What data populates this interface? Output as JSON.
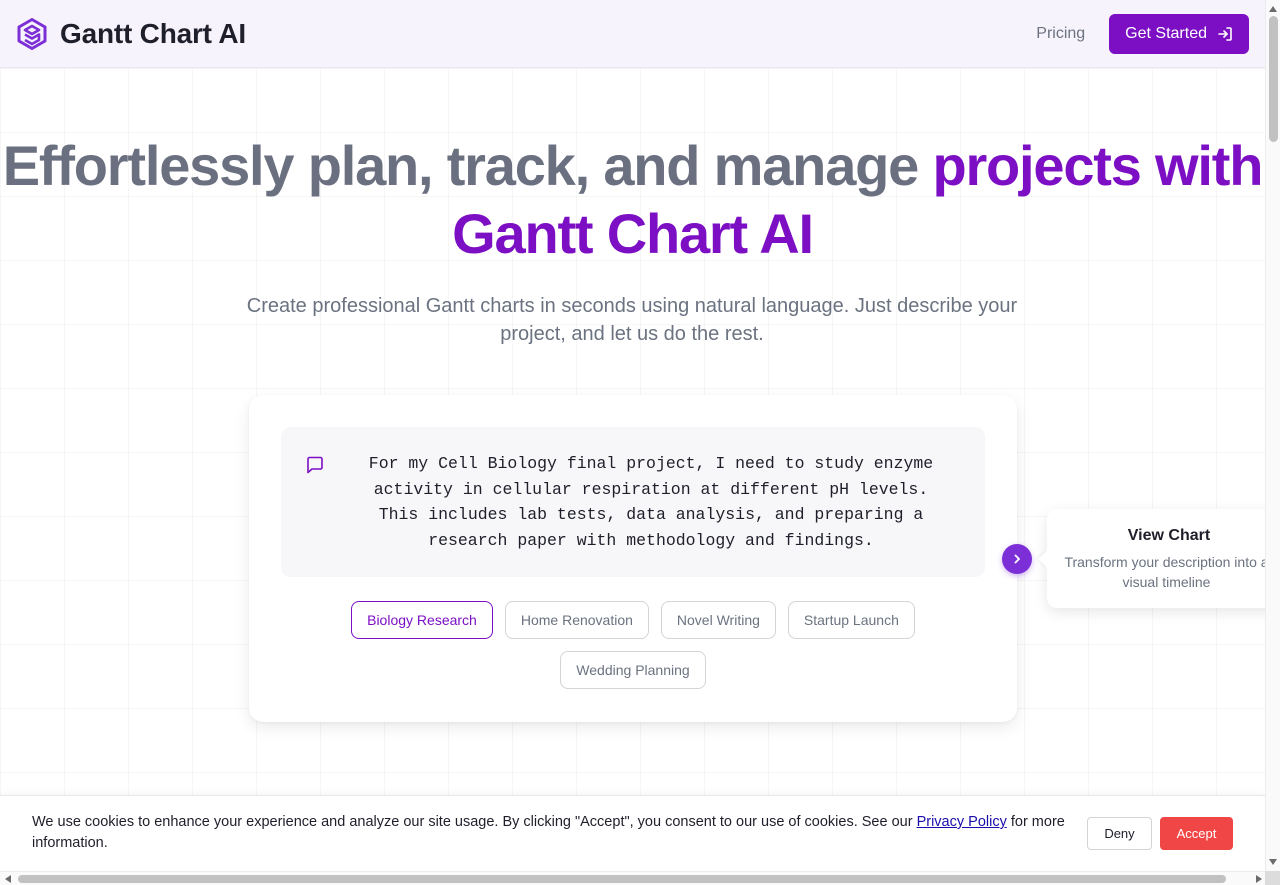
{
  "header": {
    "brand_name": "Gantt Chart AI",
    "logo_icon": "stacked-hexagon-logo",
    "nav_pricing": "Pricing",
    "cta_label": "Get Started",
    "cta_icon": "sign-in-icon"
  },
  "hero": {
    "title_part1": "Effortlessly plan, track, and manage ",
    "title_part2": "projects with Gantt Chart AI",
    "subtitle": "Create professional Gantt charts in seconds using natural language. Just describe your project, and let us do the rest."
  },
  "prompt": {
    "text": "For my Cell Biology final project, I need to study enzyme activity in cellular respiration at different pH levels. This includes lab tests, data analysis, and preparing a research paper with methodology and findings."
  },
  "examples": [
    {
      "label": "Biology Research",
      "active": true
    },
    {
      "label": "Home Renovation",
      "active": false
    },
    {
      "label": "Novel Writing",
      "active": false
    },
    {
      "label": "Startup Launch",
      "active": false
    },
    {
      "label": "Wedding Planning",
      "active": false
    }
  ],
  "tooltip": {
    "title": "View Chart",
    "description": "Transform your description into a visual timeline"
  },
  "cookie": {
    "text_before": "We use cookies to enhance your experience and analyze our site usage. By clicking \"Accept\", you consent to our use of cookies. See our ",
    "link_label": "Privacy Policy",
    "text_after": " for more information.",
    "deny_label": "Deny",
    "accept_label": "Accept"
  },
  "colors": {
    "brand_purple": "#7c0fc4",
    "accept_red": "#f14646",
    "muted_text": "#6b7280"
  }
}
